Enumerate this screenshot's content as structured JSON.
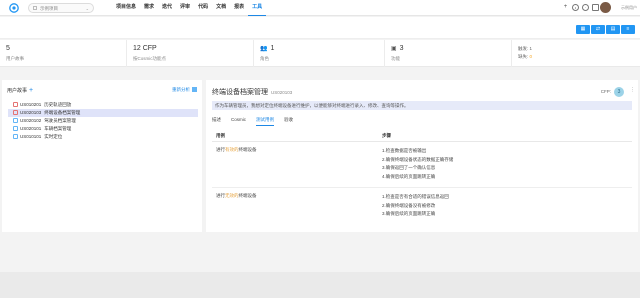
{
  "topbar": {
    "project_placeholder": "示例项目",
    "nav": [
      "项目信息",
      "需求",
      "迭代",
      "评审",
      "代码",
      "文档",
      "报表",
      "工具"
    ],
    "active_nav": "工具",
    "icons": [
      "plus-icon",
      "target-icon",
      "clock-icon",
      "expand-icon"
    ],
    "username": "示例用户"
  },
  "toolbar": {
    "buttons": [
      "grid-icon",
      "share-icon",
      "list-icon",
      "menu-icon"
    ]
  },
  "stats": [
    {
      "value": "5",
      "label": "用户故事"
    },
    {
      "value": "12 CFP",
      "label": "按Cosmic功能点"
    },
    {
      "value": "1",
      "label": "角色",
      "icon": "users-icon"
    },
    {
      "value": "3",
      "label": "功能",
      "icon": "box-icon"
    },
    {
      "mini1": "触发: 1",
      "mini2_label": "缺失:",
      "mini2_value": "0"
    }
  ],
  "left": {
    "title": "用户故事",
    "add": "+",
    "sort_label": "重新分析",
    "items": [
      {
        "id": "US010201",
        "name": "历史轨迹回放",
        "color": "red"
      },
      {
        "id": "US020103",
        "name": "终端设备档案管理",
        "color": "red",
        "selected": true
      },
      {
        "id": "US020102",
        "name": "驾驶员档案管理",
        "color": "blue"
      },
      {
        "id": "US020101",
        "name": "车辆档案管理",
        "color": "blue"
      },
      {
        "id": "US010101",
        "name": "实时定位",
        "color": "blue"
      }
    ]
  },
  "detail": {
    "title": "终端设备档案管理",
    "code": "US020103",
    "cfp_label": "CFP:",
    "cfp_value": "3",
    "description": "作为车辆管理员，我想对定位终端设备进行维护，以便能够对终端进行录入、修改、查询等操作。",
    "tabs": [
      "描述",
      "Cosmic",
      "测试用例",
      "验收"
    ],
    "active_tab": "测试用例",
    "col_case": "用例",
    "col_steps": "步骤",
    "cases": [
      {
        "pre": "进行",
        "hl": "有效的",
        "post": "终端设备",
        "steps": [
          "1.检查数据是否被输出",
          "2.确保终端设备状态的数据正确存储",
          "3.确保返回了一个确认信息",
          "4.确保后续的页面跳转正确"
        ]
      },
      {
        "pre": "进行",
        "hl": "无效的",
        "post": "终端设备",
        "steps": [
          "1.检查是否有合适的错误信息返回",
          "2.确保终端设备没有被修改",
          "3.确保后续的页面跳转正确"
        ]
      }
    ]
  },
  "colors": {
    "primary": "#2196f3",
    "selected_row": "#dfe3f9",
    "highlight": "#e6a23c"
  }
}
